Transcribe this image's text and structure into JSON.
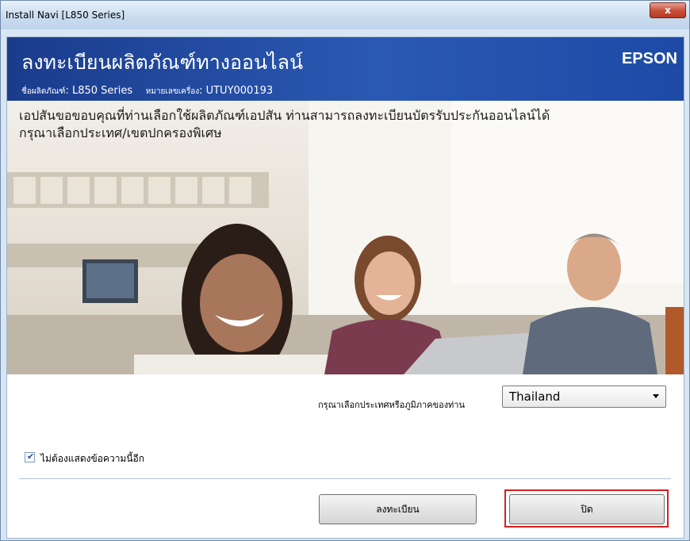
{
  "window": {
    "title": "Install Navi [L850 Series]",
    "close_label": "x"
  },
  "header": {
    "title": "ลงทะเบียนผลิตภัณฑ์ทางออนไลน์",
    "brand": "EPSON",
    "product_label": "ชื่อผลิตภัณฑ์",
    "product_value": ": L850 Series",
    "serial_label": "หมายเลขเครื่อง",
    "serial_value": ": UTUY000193"
  },
  "intro": {
    "line1": "เอปสันขอขอบคุณที่ท่านเลือกใช้ผลิตภัณฑ์เอปสัน ท่านสามารถลงทะเบียนบัตรรับประกันออนไลน์ได้",
    "line2": "กรุณาเลือกประเทศ/เขตปกครองพิเศษ"
  },
  "region": {
    "label": "กรุณาเลือกประเทศหรือภูมิภาคของท่าน",
    "selected": "Thailand"
  },
  "checkbox": {
    "label": "ไม่ต้องแสดงข้อความนี้อีก",
    "checked": true
  },
  "buttons": {
    "register": "ลงทะเบียน",
    "close": "ปิด"
  },
  "colors": {
    "header_bg": "#1f4a9f",
    "highlight": "#d61f1f"
  }
}
